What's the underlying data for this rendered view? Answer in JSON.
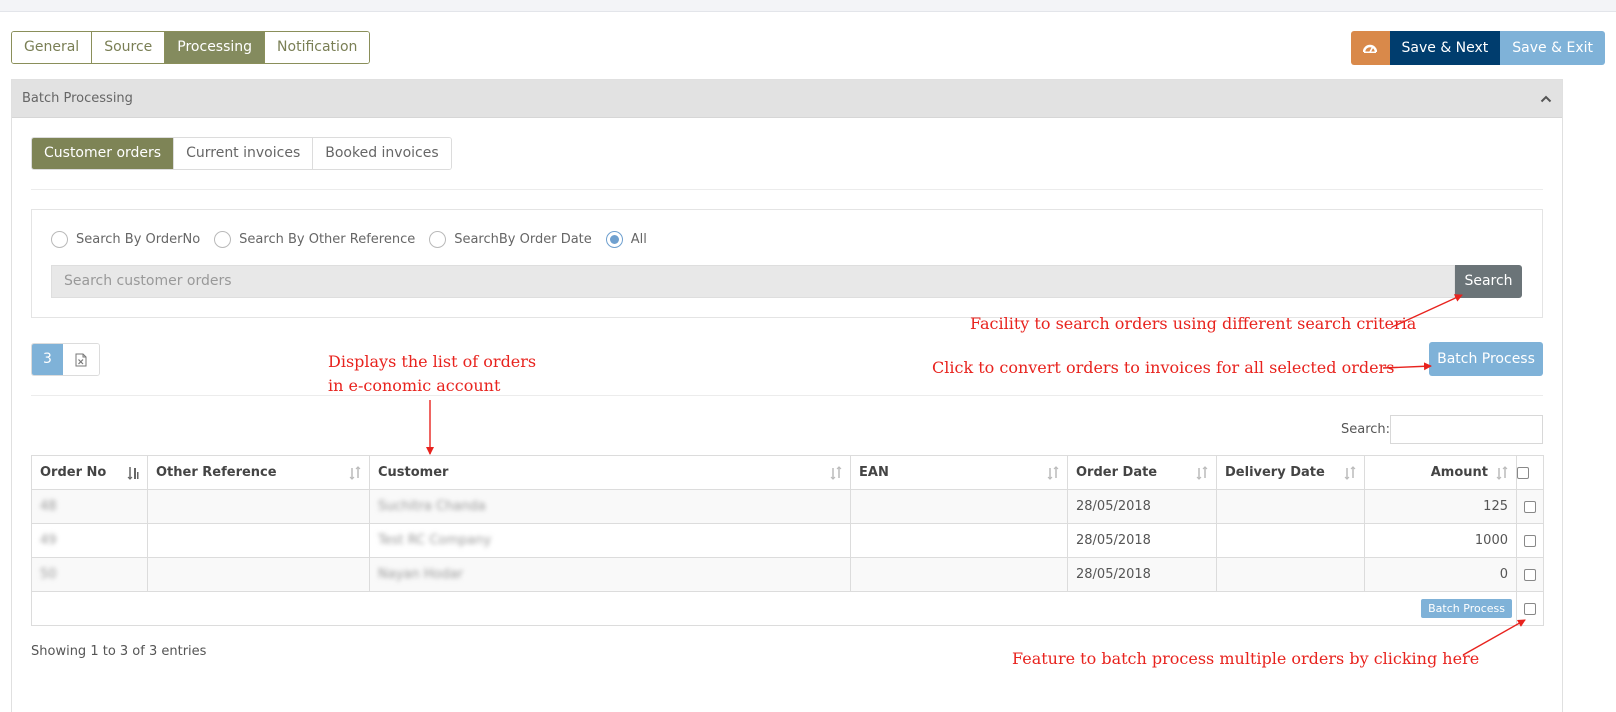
{
  "step_tabs": [
    {
      "label": "General",
      "active": false
    },
    {
      "label": "Source",
      "active": false
    },
    {
      "label": "Processing",
      "active": true
    },
    {
      "label": "Notification",
      "active": false
    }
  ],
  "top_actions": {
    "dashboard_icon": "dashboard-icon",
    "save_next": "Save & Next",
    "save_exit": "Save & Exit"
  },
  "panel": {
    "title": "Batch Processing",
    "collapse_icon": "chevron-up-icon"
  },
  "order_tabs": [
    {
      "label": "Customer orders",
      "active": true
    },
    {
      "label": "Current invoices",
      "active": false
    },
    {
      "label": "Booked invoices",
      "active": false
    }
  ],
  "search": {
    "options": [
      {
        "label": "Search By OrderNo",
        "checked": false
      },
      {
        "label": "Search By Other Reference",
        "checked": false
      },
      {
        "label": "SearchBy Order Date",
        "checked": false
      },
      {
        "label": "All",
        "checked": true
      }
    ],
    "placeholder": "Search customer orders",
    "button": "Search"
  },
  "toolbar": {
    "count": "3",
    "export_icon": "excel-export-icon",
    "batch_process": "Batch Process"
  },
  "table_search": {
    "label": "Search:"
  },
  "table": {
    "columns": [
      "Order No",
      "Other Reference",
      "Customer",
      "EAN",
      "Order Date",
      "Delivery Date",
      "Amount"
    ],
    "rows": [
      {
        "order_no": "48",
        "other_ref": "",
        "customer": "Suchitra Chanda",
        "ean": "",
        "order_date": "28/05/2018",
        "delivery_date": "",
        "amount": "125"
      },
      {
        "order_no": "49",
        "other_ref": "",
        "customer": "Test RC Company",
        "ean": "",
        "order_date": "28/05/2018",
        "delivery_date": "",
        "amount": "1000"
      },
      {
        "order_no": "50",
        "other_ref": "",
        "customer": "Nayan Hodar",
        "ean": "",
        "order_date": "28/05/2018",
        "delivery_date": "",
        "amount": "0"
      }
    ],
    "footer_batch": "Batch Process"
  },
  "showing": "Showing 1 to 3 of 3 entries",
  "annotations": {
    "search": "Facility to search orders using different search criteria",
    "convert": "Click to convert orders to invoices for all selected orders",
    "list_line1": "Displays the list of orders",
    "list_line2": "in e-conomic account",
    "batch": "Feature to batch process multiple orders by clicking here"
  },
  "colors": {
    "olive": "#848b5e",
    "navy": "#003d6e",
    "light_blue": "#7fb2d8",
    "orange": "#d9894a",
    "annotation_red": "#e8231e"
  }
}
